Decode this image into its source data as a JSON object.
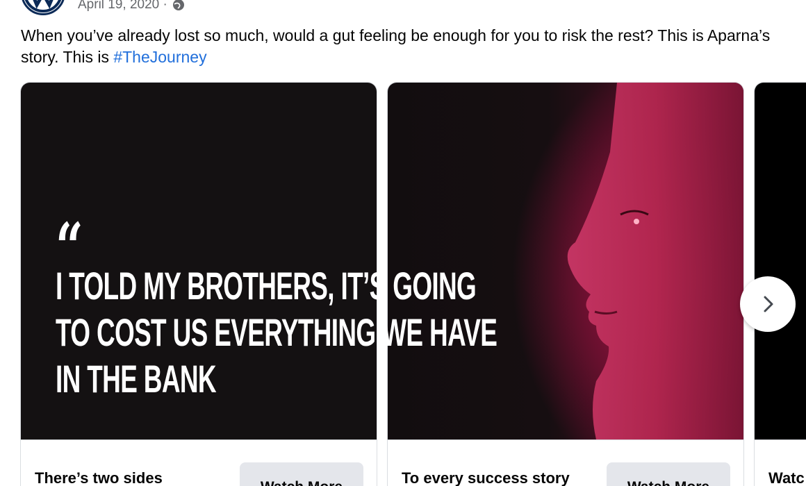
{
  "post": {
    "date": "April 19, 2020 ·",
    "text": "When you’ve already lost so much, would a gut feeling be enough for you to risk the rest? This is Aparna’s story. This is ",
    "hashtag": "#TheJourney",
    "privacy_icon": "globe-icon",
    "avatar_icon": "vw-logo-icon"
  },
  "quote": {
    "mark": "“",
    "lines": [
      "I told my brothers, it’s going",
      "to cost us everything we have",
      "in the bank"
    ]
  },
  "cards": [
    {
      "title": "There’s two sides",
      "button": "Watch More"
    },
    {
      "title": "To every success story",
      "button": "Watch More"
    },
    {
      "title": "Watc"
    }
  ],
  "carousel": {
    "next_icon": "chevron-right-icon"
  },
  "colors": {
    "hashtag": "#216fdb",
    "button_bg": "#e4e6eb",
    "media_dark": "#141112",
    "media_red": "#a31c47"
  }
}
